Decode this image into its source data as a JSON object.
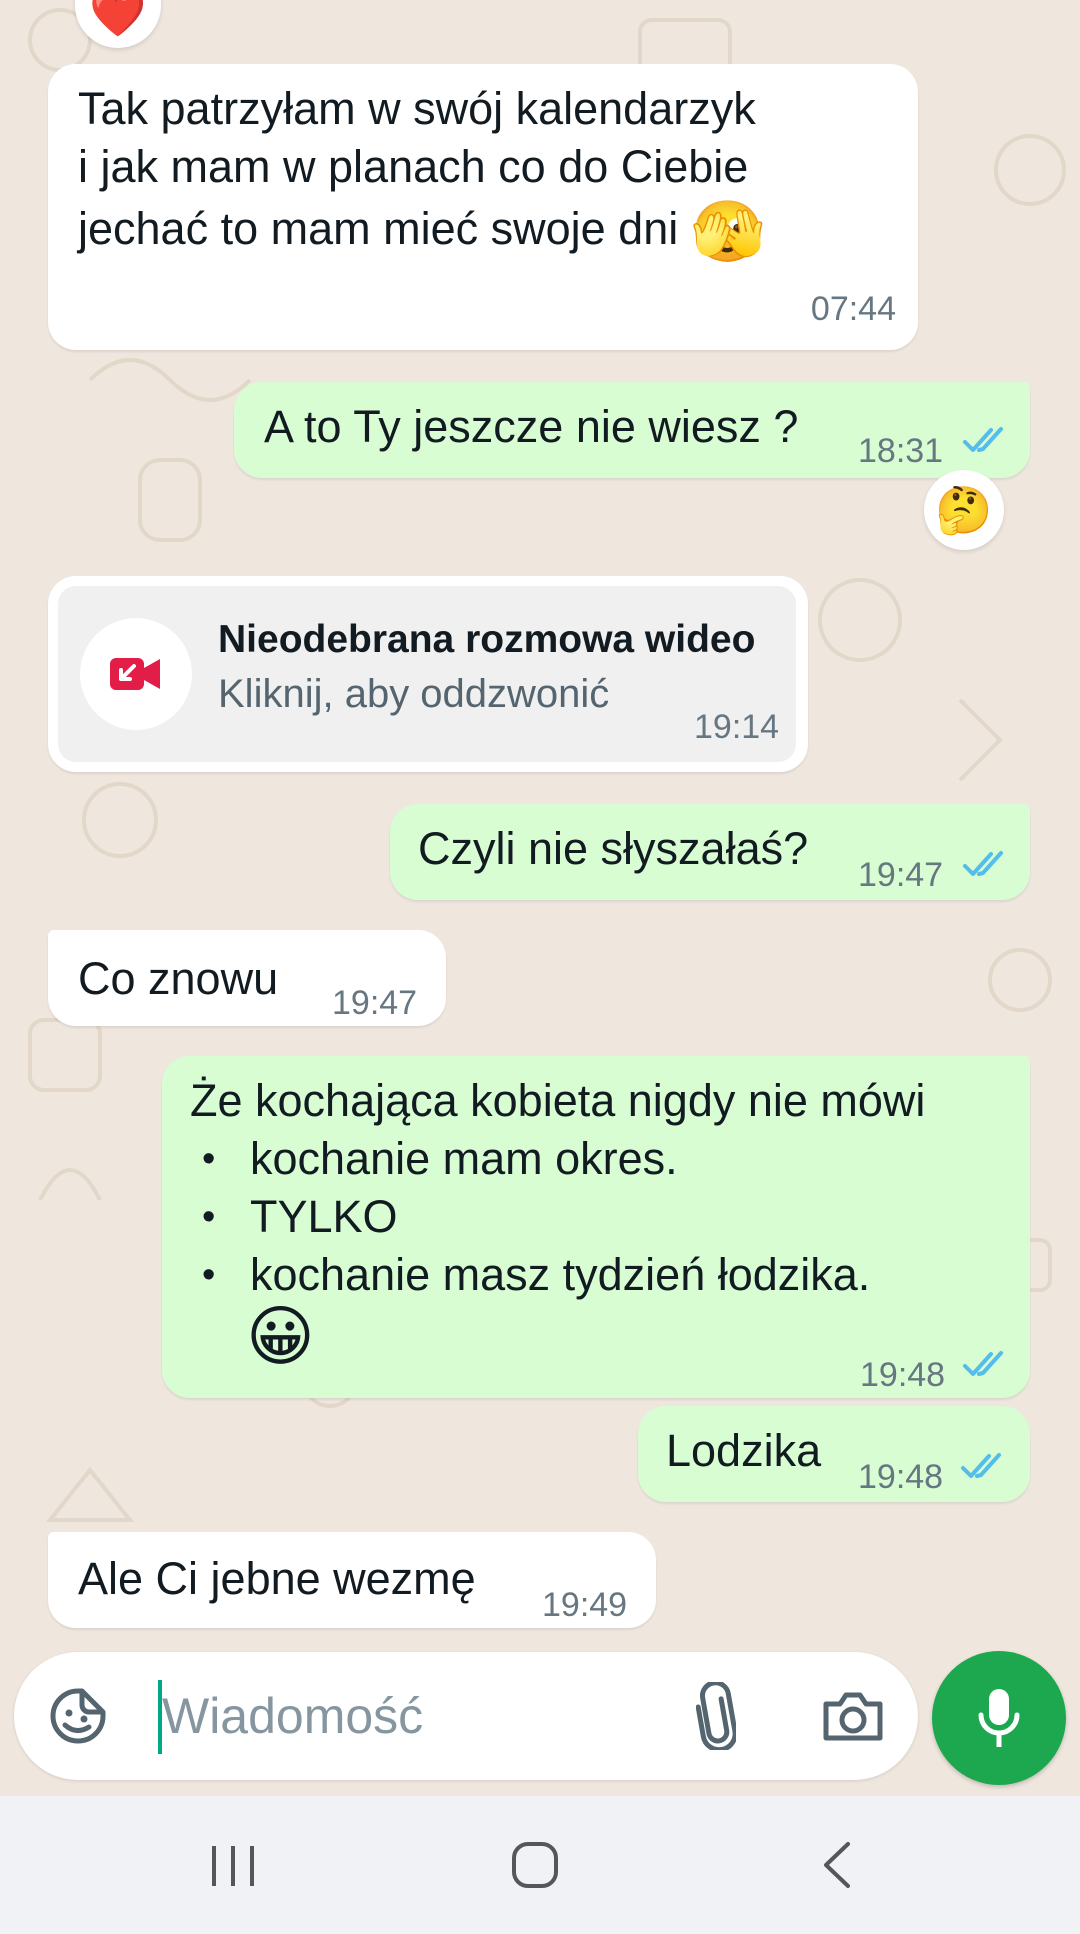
{
  "messages": [
    {
      "type": "incoming",
      "lines": [
        "Tak patrzyłam w swój kalendarzyk",
        "i jak mam w planach co do Ciebie",
        "jechać to mam mieć swoje dni"
      ],
      "emoji": "🫣",
      "time": "07:44"
    },
    {
      "type": "outgoing",
      "text": "A to Ty jeszcze nie wiesz ?",
      "time": "18:31",
      "reaction": "🤔"
    },
    {
      "type": "call",
      "title": "Nieodebrana rozmowa wideo",
      "subtitle": "Kliknij, aby oddzwonić",
      "time": "19:14"
    },
    {
      "type": "outgoing",
      "text": "Czyli nie słyszałaś?",
      "time": "19:47"
    },
    {
      "type": "incoming",
      "text": "Co znowu",
      "time": "19:47"
    },
    {
      "type": "outgoing",
      "intro": "Że kochająca kobieta nigdy nie mówi",
      "items": [
        "kochanie mam okres.",
        "TYLKO",
        "kochanie masz tydzień łodzika."
      ],
      "emoji": "😀",
      "time": "19:48"
    },
    {
      "type": "outgoing",
      "text": "Lodzika",
      "time": "19:48"
    },
    {
      "type": "incoming",
      "text": "Ale Ci jebne wezmę",
      "time": "19:49"
    }
  ],
  "top_reaction": "❤️",
  "composer": {
    "placeholder": "Wiadomość"
  },
  "colors": {
    "incoming": "#ffffff",
    "outgoing": "#d9fdd3",
    "read_ticks": "#53bdeb",
    "accent": "#1da850",
    "missed_call": "#e11d48"
  },
  "icons": [
    "sticker-icon",
    "attach-icon",
    "camera-icon",
    "mic-icon",
    "video-call-missed-icon",
    "recent-apps-icon",
    "home-icon",
    "back-icon"
  ]
}
